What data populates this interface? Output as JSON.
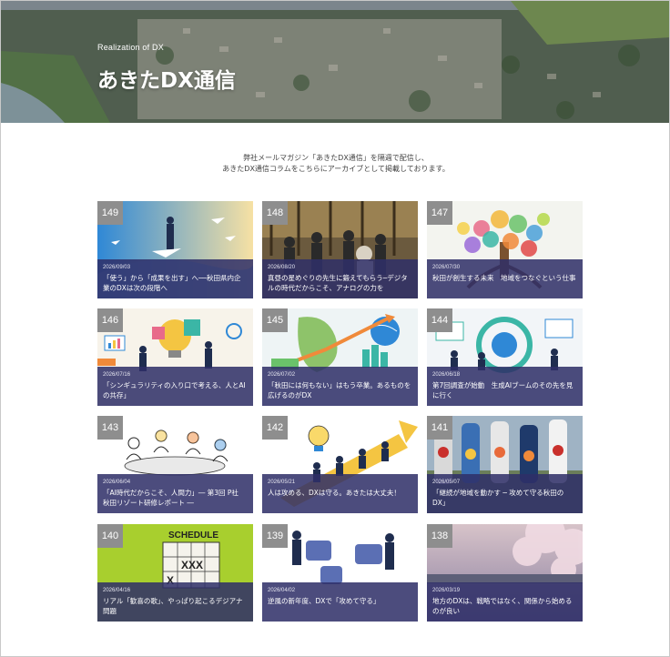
{
  "hero": {
    "subtitle": "Realization of DX",
    "title": "あきたDX通信"
  },
  "intro": {
    "line1": "弊社メールマガジン「あきたDX通信」を隔週で配信し、",
    "line2": "あきたDX通信コラムをこちらにアーカイブとして掲載しております。"
  },
  "cards": [
    {
      "num": "149",
      "date": "2026/09/03",
      "title": "「使う」から「成果を出す」へ──秋田県内企\n業のDXは次の段階へ"
    },
    {
      "num": "148",
      "date": "2026/08/20",
      "title": "真昼の星めぐりの先生に鍛えてもらう─デジタ\nルの時代だからこそ、アナログの力を"
    },
    {
      "num": "147",
      "date": "2026/07/30",
      "title": "秋田が創生する未来　地域をつなぐという仕事"
    },
    {
      "num": "146",
      "date": "2026/07/16",
      "title": "「シンギュラリティの入り口で考える、人とAI\nの共存」"
    },
    {
      "num": "145",
      "date": "2026/07/02",
      "title": "「秋田には何もない」はもう卒業。あるものを\n広げるのがDX"
    },
    {
      "num": "144",
      "date": "2026/06/18",
      "title": "第7回調査が始動　生成AIブームのその先を見\nに行く"
    },
    {
      "num": "143",
      "date": "2026/06/04",
      "title": "「AI時代だからこそ、人間力」― 第3回 P社\n秋田リゾート研修レポート ―"
    },
    {
      "num": "142",
      "date": "2026/05/21",
      "title": "人は攻める、DXは守る。あきたは大丈夫！"
    },
    {
      "num": "141",
      "date": "2026/05/07",
      "title": "「継続が地域を動かす ─ 攻めて守る秋田の\nDX」"
    },
    {
      "num": "140",
      "date": "2026/04/16",
      "title": "リアル「歓喜の歌」、やっぱり起こるデジアナ\n問題"
    },
    {
      "num": "139",
      "date": "2026/04/02",
      "title": "逆風の新年度、DXで「攻めて守る」"
    },
    {
      "num": "138",
      "date": "2026/03/19",
      "title": "地方のDXは、戦略ではなく、関係から始める\nのが良い"
    }
  ],
  "art_text": {
    "schedule": "SCHEDULE",
    "xxx": "XXX",
    "x": "X"
  }
}
